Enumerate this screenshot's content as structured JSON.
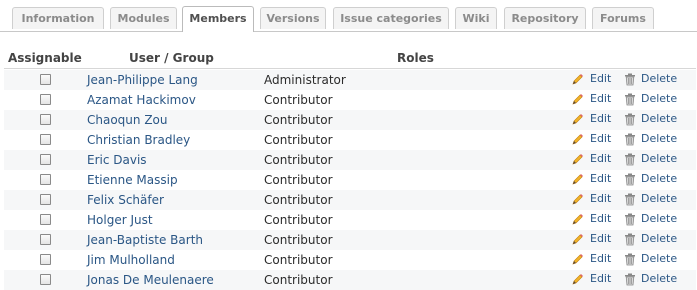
{
  "tabs": [
    {
      "label": "Information",
      "selected": false
    },
    {
      "label": "Modules",
      "selected": false
    },
    {
      "label": "Members",
      "selected": true
    },
    {
      "label": "Versions",
      "selected": false
    },
    {
      "label": "Issue categories",
      "selected": false
    },
    {
      "label": "Wiki",
      "selected": false
    },
    {
      "label": "Repository",
      "selected": false
    },
    {
      "label": "Forums",
      "selected": false
    }
  ],
  "table": {
    "headers": {
      "assignable": "Assignable",
      "user": "User / Group",
      "roles": "Roles"
    },
    "edit_label": "Edit",
    "delete_label": "Delete",
    "rows": [
      {
        "user": "Jean-Philippe Lang",
        "role": "Administrator"
      },
      {
        "user": "Azamat Hackimov",
        "role": "Contributor"
      },
      {
        "user": "Chaoqun Zou",
        "role": "Contributor"
      },
      {
        "user": "Christian Bradley",
        "role": "Contributor"
      },
      {
        "user": "Eric Davis",
        "role": "Contributor"
      },
      {
        "user": "Etienne Massip",
        "role": "Contributor"
      },
      {
        "user": "Felix Schäfer",
        "role": "Contributor"
      },
      {
        "user": "Holger Just",
        "role": "Contributor"
      },
      {
        "user": "Jean-Baptiste Barth",
        "role": "Contributor"
      },
      {
        "user": "Jim Mulholland",
        "role": "Contributor"
      },
      {
        "user": "Jonas De Meulenaere",
        "role": "Contributor"
      }
    ]
  },
  "colors": {
    "link": "#2a5685",
    "tab_text": "#8b8b8b",
    "selected_tab_text": "#505050",
    "row_alt": "#f6f7f8"
  },
  "icons": {
    "edit": "pencil-icon",
    "delete": "trash-icon"
  }
}
